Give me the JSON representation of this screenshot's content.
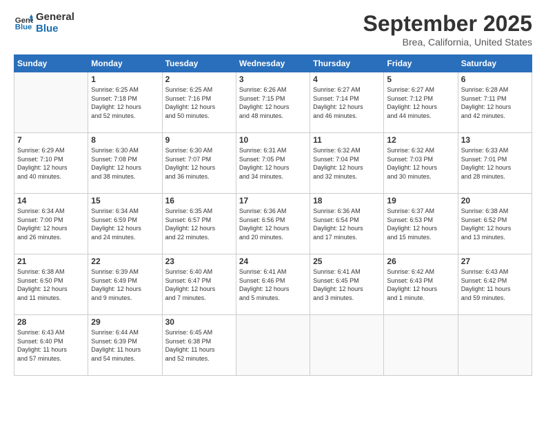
{
  "header": {
    "logo_line1": "General",
    "logo_line2": "Blue",
    "month_title": "September 2025",
    "location": "Brea, California, United States"
  },
  "weekdays": [
    "Sunday",
    "Monday",
    "Tuesday",
    "Wednesday",
    "Thursday",
    "Friday",
    "Saturday"
  ],
  "weeks": [
    [
      {
        "day": "",
        "info": ""
      },
      {
        "day": "1",
        "info": "Sunrise: 6:25 AM\nSunset: 7:18 PM\nDaylight: 12 hours\nand 52 minutes."
      },
      {
        "day": "2",
        "info": "Sunrise: 6:25 AM\nSunset: 7:16 PM\nDaylight: 12 hours\nand 50 minutes."
      },
      {
        "day": "3",
        "info": "Sunrise: 6:26 AM\nSunset: 7:15 PM\nDaylight: 12 hours\nand 48 minutes."
      },
      {
        "day": "4",
        "info": "Sunrise: 6:27 AM\nSunset: 7:14 PM\nDaylight: 12 hours\nand 46 minutes."
      },
      {
        "day": "5",
        "info": "Sunrise: 6:27 AM\nSunset: 7:12 PM\nDaylight: 12 hours\nand 44 minutes."
      },
      {
        "day": "6",
        "info": "Sunrise: 6:28 AM\nSunset: 7:11 PM\nDaylight: 12 hours\nand 42 minutes."
      }
    ],
    [
      {
        "day": "7",
        "info": "Sunrise: 6:29 AM\nSunset: 7:10 PM\nDaylight: 12 hours\nand 40 minutes."
      },
      {
        "day": "8",
        "info": "Sunrise: 6:30 AM\nSunset: 7:08 PM\nDaylight: 12 hours\nand 38 minutes."
      },
      {
        "day": "9",
        "info": "Sunrise: 6:30 AM\nSunset: 7:07 PM\nDaylight: 12 hours\nand 36 minutes."
      },
      {
        "day": "10",
        "info": "Sunrise: 6:31 AM\nSunset: 7:05 PM\nDaylight: 12 hours\nand 34 minutes."
      },
      {
        "day": "11",
        "info": "Sunrise: 6:32 AM\nSunset: 7:04 PM\nDaylight: 12 hours\nand 32 minutes."
      },
      {
        "day": "12",
        "info": "Sunrise: 6:32 AM\nSunset: 7:03 PM\nDaylight: 12 hours\nand 30 minutes."
      },
      {
        "day": "13",
        "info": "Sunrise: 6:33 AM\nSunset: 7:01 PM\nDaylight: 12 hours\nand 28 minutes."
      }
    ],
    [
      {
        "day": "14",
        "info": "Sunrise: 6:34 AM\nSunset: 7:00 PM\nDaylight: 12 hours\nand 26 minutes."
      },
      {
        "day": "15",
        "info": "Sunrise: 6:34 AM\nSunset: 6:59 PM\nDaylight: 12 hours\nand 24 minutes."
      },
      {
        "day": "16",
        "info": "Sunrise: 6:35 AM\nSunset: 6:57 PM\nDaylight: 12 hours\nand 22 minutes."
      },
      {
        "day": "17",
        "info": "Sunrise: 6:36 AM\nSunset: 6:56 PM\nDaylight: 12 hours\nand 20 minutes."
      },
      {
        "day": "18",
        "info": "Sunrise: 6:36 AM\nSunset: 6:54 PM\nDaylight: 12 hours\nand 17 minutes."
      },
      {
        "day": "19",
        "info": "Sunrise: 6:37 AM\nSunset: 6:53 PM\nDaylight: 12 hours\nand 15 minutes."
      },
      {
        "day": "20",
        "info": "Sunrise: 6:38 AM\nSunset: 6:52 PM\nDaylight: 12 hours\nand 13 minutes."
      }
    ],
    [
      {
        "day": "21",
        "info": "Sunrise: 6:38 AM\nSunset: 6:50 PM\nDaylight: 12 hours\nand 11 minutes."
      },
      {
        "day": "22",
        "info": "Sunrise: 6:39 AM\nSunset: 6:49 PM\nDaylight: 12 hours\nand 9 minutes."
      },
      {
        "day": "23",
        "info": "Sunrise: 6:40 AM\nSunset: 6:47 PM\nDaylight: 12 hours\nand 7 minutes."
      },
      {
        "day": "24",
        "info": "Sunrise: 6:41 AM\nSunset: 6:46 PM\nDaylight: 12 hours\nand 5 minutes."
      },
      {
        "day": "25",
        "info": "Sunrise: 6:41 AM\nSunset: 6:45 PM\nDaylight: 12 hours\nand 3 minutes."
      },
      {
        "day": "26",
        "info": "Sunrise: 6:42 AM\nSunset: 6:43 PM\nDaylight: 12 hours\nand 1 minute."
      },
      {
        "day": "27",
        "info": "Sunrise: 6:43 AM\nSunset: 6:42 PM\nDaylight: 11 hours\nand 59 minutes."
      }
    ],
    [
      {
        "day": "28",
        "info": "Sunrise: 6:43 AM\nSunset: 6:40 PM\nDaylight: 11 hours\nand 57 minutes."
      },
      {
        "day": "29",
        "info": "Sunrise: 6:44 AM\nSunset: 6:39 PM\nDaylight: 11 hours\nand 54 minutes."
      },
      {
        "day": "30",
        "info": "Sunrise: 6:45 AM\nSunset: 6:38 PM\nDaylight: 11 hours\nand 52 minutes."
      },
      {
        "day": "",
        "info": ""
      },
      {
        "day": "",
        "info": ""
      },
      {
        "day": "",
        "info": ""
      },
      {
        "day": "",
        "info": ""
      }
    ]
  ]
}
